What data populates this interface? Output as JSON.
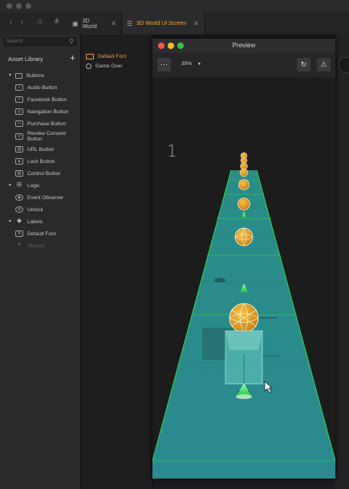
{
  "tabs": [
    {
      "label": "3D World"
    },
    {
      "label": "3D World UI Screen"
    }
  ],
  "sidebar": {
    "search_placeholder": "Search",
    "title": "Asset Library",
    "groups": [
      {
        "label": "Buttons",
        "items": [
          "Audio Button",
          "Facebook Button",
          "Navigation Button",
          "Purchase Button",
          "Revoke Consent Button",
          "URL Button",
          "Lock Button",
          "Control Button"
        ]
      },
      {
        "label": "Logic",
        "items": [
          "Event Observer",
          "Unlock"
        ]
      },
      {
        "label": "Labels",
        "items": [
          "Default Font",
          "Objects"
        ]
      }
    ]
  },
  "objects_panel": {
    "items": [
      "Default Font",
      "Game Over"
    ]
  },
  "preview": {
    "title": "Preview",
    "more_label": "···",
    "zoom": "30%",
    "score": "1"
  },
  "colors": {
    "accent": "#f0a030",
    "road": "#2f8a8c",
    "road_edge": "#2fd84a",
    "ball": "#e8a020"
  }
}
